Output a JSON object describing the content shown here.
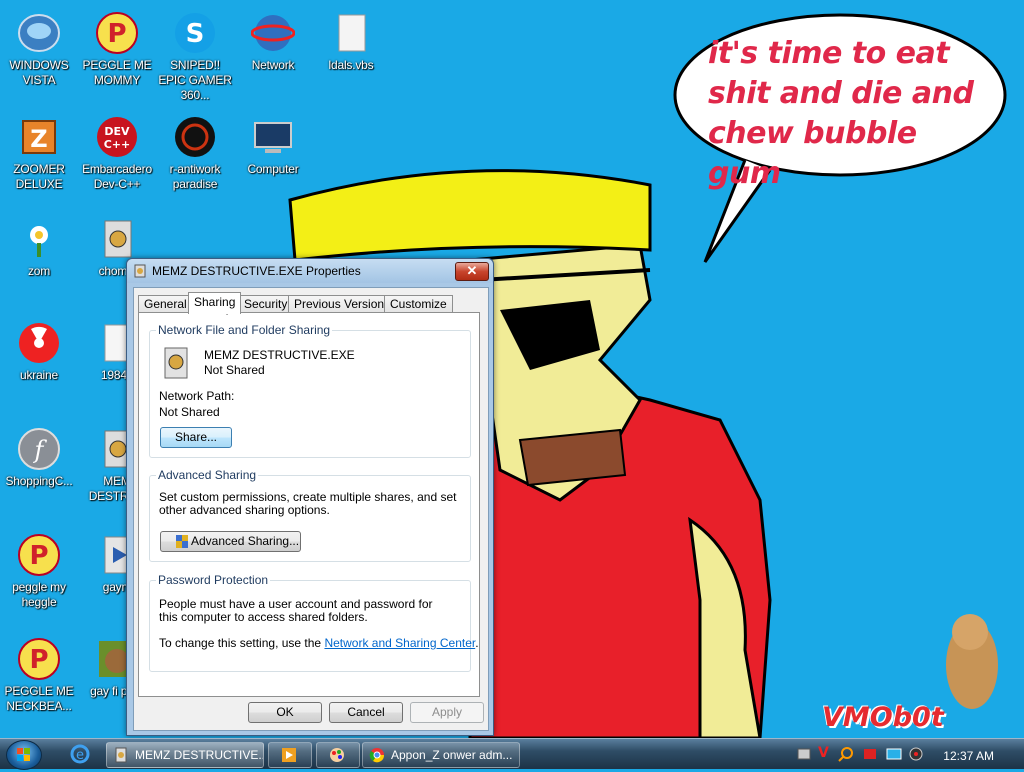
{
  "speech_bubble": {
    "text": "it's time to eat shit and die and chew bubble gum"
  },
  "watermark": {
    "text": "VMOb0t"
  },
  "desktop_icons": [
    {
      "label": "WINDOWS VISTA",
      "icon": "vista-disk-icon"
    },
    {
      "label": "PEGGLE ME MOMMY",
      "icon": "peggle-icon"
    },
    {
      "label": "SNIPED!! EPIC GAMER 360...",
      "icon": "skype-icon"
    },
    {
      "label": "Network",
      "icon": "network-globe-icon"
    },
    {
      "label": "ldals.vbs",
      "icon": "script-file-icon"
    },
    {
      "label": "ZOOMER DELUXE",
      "icon": "zoomer-icon"
    },
    {
      "label": "Embarcadero Dev-C++",
      "icon": "devcpp-icon"
    },
    {
      "label": "r-antiwork paradise",
      "icon": "antiwork-icon"
    },
    {
      "label": "Computer",
      "icon": "computer-icon"
    },
    {
      "label": "zom",
      "icon": "flower-icon"
    },
    {
      "label": "chomik",
      "icon": "exe-file-icon"
    },
    {
      "label": "ukraine",
      "icon": "radiation-icon"
    },
    {
      "label": "1984.t",
      "icon": "text-file-icon"
    },
    {
      "label": "ShoppingC...",
      "icon": "flash-icon"
    },
    {
      "label": "MEM DESTRUC",
      "icon": "exe-file-icon"
    },
    {
      "label": "peggle my heggle",
      "icon": "peggle-icon"
    },
    {
      "label": "gaym",
      "icon": "media-icon"
    },
    {
      "label": "PEGGLE ME NECKBEA...",
      "icon": "peggle-icon"
    },
    {
      "label": "gay fi porn",
      "icon": "bear-icon"
    }
  ],
  "dialog": {
    "title": "MEMZ DESTRUCTIVE.EXE Properties",
    "close_label": "✕",
    "tabs": [
      "General",
      "Sharing",
      "Security",
      "Previous Versions",
      "Customize"
    ],
    "active_tab": "Sharing",
    "network_sharing": {
      "title": "Network File and Folder Sharing",
      "file_name": "MEMZ DESTRUCTIVE.EXE",
      "status": "Not Shared",
      "path_label": "Network Path:",
      "path_value": "Not Shared",
      "share_button": "Share..."
    },
    "advanced_sharing": {
      "title": "Advanced Sharing",
      "description": "Set custom permissions, create multiple shares, and set other advanced sharing options.",
      "button": "Advanced Sharing..."
    },
    "password_protection": {
      "title": "Password Protection",
      "description": "People must have a user account and password for this computer to access shared folders.",
      "change_prefix": "To change this setting, use the",
      "link_text": "Network and Sharing Center",
      "change_suffix": "."
    },
    "buttons": {
      "ok": "OK",
      "cancel": "Cancel",
      "apply": "Apply"
    }
  },
  "taskbar": {
    "items": [
      {
        "label": "MEMZ DESTRUCTIVE...",
        "icon": "exe-file-icon",
        "active": true
      },
      {
        "label": "",
        "icon": "media-player-icon",
        "active": false
      },
      {
        "label": "",
        "icon": "paint-icon",
        "active": false
      },
      {
        "label": "Appon_Z onwer adm...",
        "icon": "chrome-icon",
        "active": false
      }
    ],
    "clock": "12:37 AM"
  }
}
